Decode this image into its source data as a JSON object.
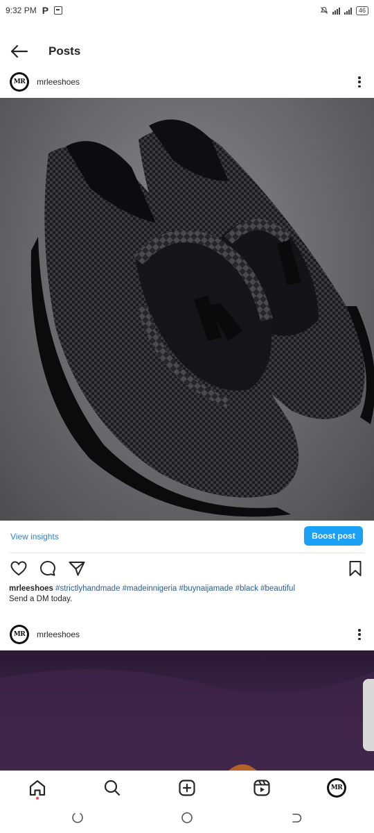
{
  "status_bar": {
    "time": "9:32 PM",
    "battery": "46"
  },
  "header": {
    "title": "Posts"
  },
  "post1": {
    "username": "mrleeshoes",
    "avatar_text": "MR",
    "view_insights": "View insights",
    "boost_label": "Boost post",
    "caption_user": "mrleeshoes",
    "caption_tags": "#strictlyhandmade #madeinnigeria #buynaijamade #black #beautiful",
    "caption_line2": "Send a DM today."
  },
  "post2": {
    "username": "mrleeshoes",
    "avatar_text": "MR"
  },
  "bottom_nav": {
    "items": [
      "home-icon",
      "search-icon",
      "create-icon",
      "reels-icon",
      "profile-avatar"
    ]
  },
  "colors": {
    "link": "#2a82d6",
    "boost": "#1aa0f5",
    "hashtag": "#2a5d99",
    "notification_dot": "#ed4956"
  }
}
